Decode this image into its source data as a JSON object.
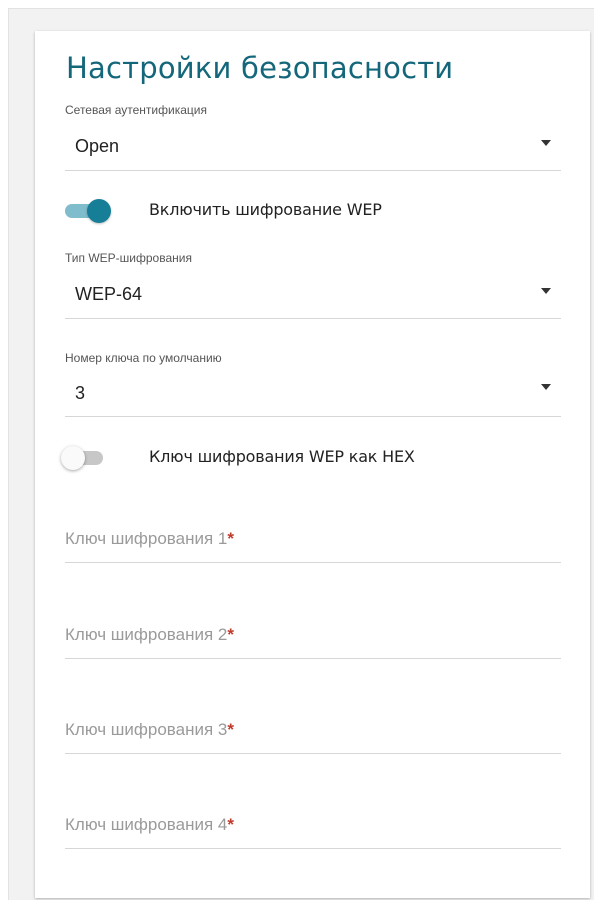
{
  "section": {
    "title": "Настройки безопасности"
  },
  "auth": {
    "label": "Сетевая аутентификация",
    "value": "Open"
  },
  "wep_enable": {
    "label": "Включить шифрование WEP",
    "checked": true
  },
  "wep_type": {
    "label": "Тип WEP-шифрования",
    "value": "WEP-64"
  },
  "default_key": {
    "label": "Номер ключа по умолчанию",
    "value": "3"
  },
  "hex_toggle": {
    "label": "Ключ шифрования WEP как HEX",
    "checked": false
  },
  "keys": [
    {
      "placeholder": "Ключ шифрования 1",
      "required_mark": "*"
    },
    {
      "placeholder": "Ключ шифрования 2",
      "required_mark": "*"
    },
    {
      "placeholder": "Ключ шифрования 3",
      "required_mark": "*"
    },
    {
      "placeholder": "Ключ шифрования 4",
      "required_mark": "*"
    }
  ],
  "colors": {
    "accent": "#167e96",
    "title": "#14677a",
    "required": "#c0392b"
  }
}
